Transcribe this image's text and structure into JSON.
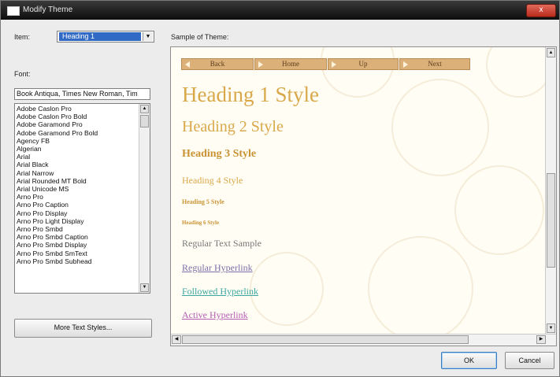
{
  "window": {
    "title": "Modify Theme",
    "close_label": "x"
  },
  "item": {
    "label": "Item:",
    "value": "Heading 1"
  },
  "font": {
    "label": "Font:",
    "value": "Book Antiqua, Times New Roman, Tim",
    "list": [
      "Adobe Caslon Pro",
      "Adobe Caslon Pro Bold",
      "Adobe Garamond Pro",
      "Adobe Garamond Pro Bold",
      "Agency FB",
      "Algerian",
      "Arial",
      "Arial Black",
      "Arial Narrow",
      "Arial Rounded MT Bold",
      "Arial Unicode MS",
      "Arno Pro",
      "Arno Pro Caption",
      "Arno Pro Display",
      "Arno Pro Light Display",
      "Arno Pro Smbd",
      "Arno Pro Smbd Caption",
      "Arno Pro Smbd Display",
      "Arno Pro Smbd SmText",
      "Arno Pro Smbd Subhead"
    ]
  },
  "more_styles_label": "More Text Styles...",
  "sample": {
    "label": "Sample of Theme:",
    "nav": {
      "back": "Back",
      "home": "Home",
      "up": "Up",
      "next": "Next"
    },
    "heading1": "Heading 1 Style",
    "heading2": "Heading 2 Style",
    "heading3": "Heading 3 Style",
    "heading4": "Heading 4 Style",
    "heading5": "Heading 5 Style",
    "heading6": "Heading 6 Style",
    "regular": "Regular Text Sample",
    "hyperlink": "Regular Hyperlink",
    "followed": "Followed Hyperlink",
    "active": "Active Hyperlink"
  },
  "buttons": {
    "ok": "OK",
    "cancel": "Cancel"
  },
  "colors": {
    "heading": "#d9a84a",
    "nav_button": "#dcb079",
    "link": "#7b6fa8",
    "followed_link": "#3ba7a0",
    "active_link": "#b55cb2",
    "selection": "#316ac5"
  }
}
